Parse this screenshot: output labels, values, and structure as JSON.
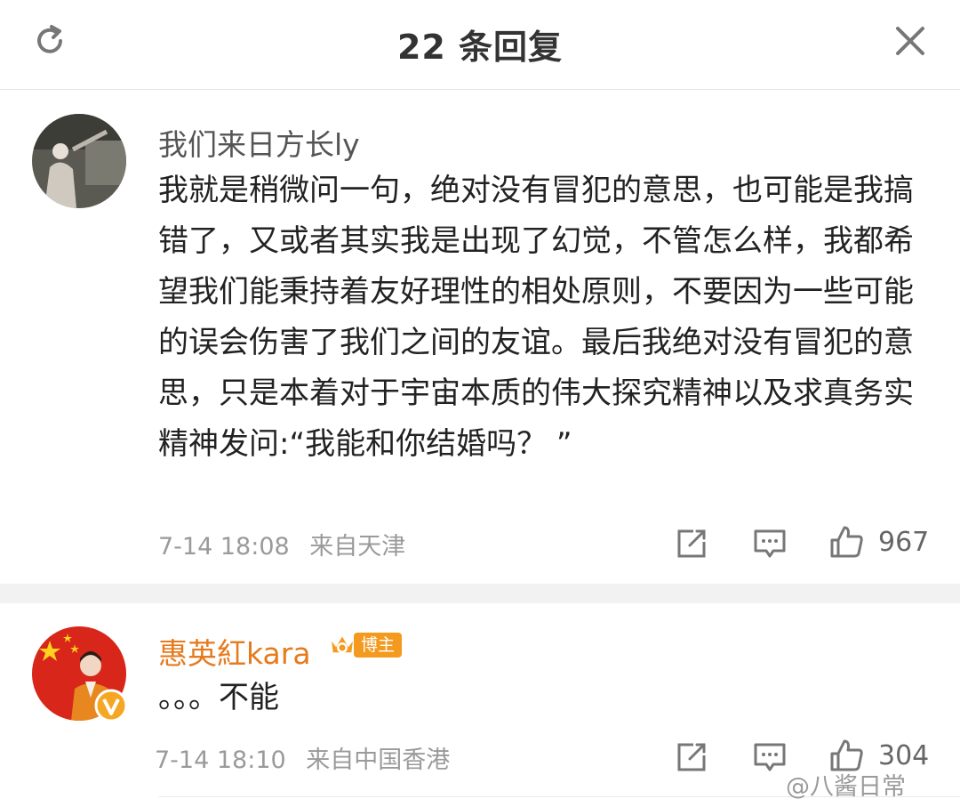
{
  "header": {
    "title": "22 条回复"
  },
  "comments": [
    {
      "username": "我们来日方长ly",
      "text": "我就是稍微问一句，绝对没有冒犯的意思，也可能是我搞错了，又或者其实我是出现了幻觉，不管怎么样，我都希望我们能秉持着友好理性的相处原则，不要因为一些可能的误会伤害了我们之间的友谊。最后我绝对没有冒犯的意思，只是本着对于宇宙本质的伟大探究精神以及求真务实精神发问:“我能和你结婚吗？ ”",
      "time": "7-14 18:08",
      "location": "来自天津",
      "likes": "967"
    },
    {
      "username": "惠英紅kara",
      "badge": "博主",
      "text": "。。。不能",
      "time": "7-14 18:10",
      "location": "来自中国香港",
      "likes": "304"
    }
  ],
  "watermark": "@八酱日常",
  "colors": {
    "author_name": "#e67a1c",
    "badge": "#f39a1f",
    "verified": "#f5a623"
  }
}
